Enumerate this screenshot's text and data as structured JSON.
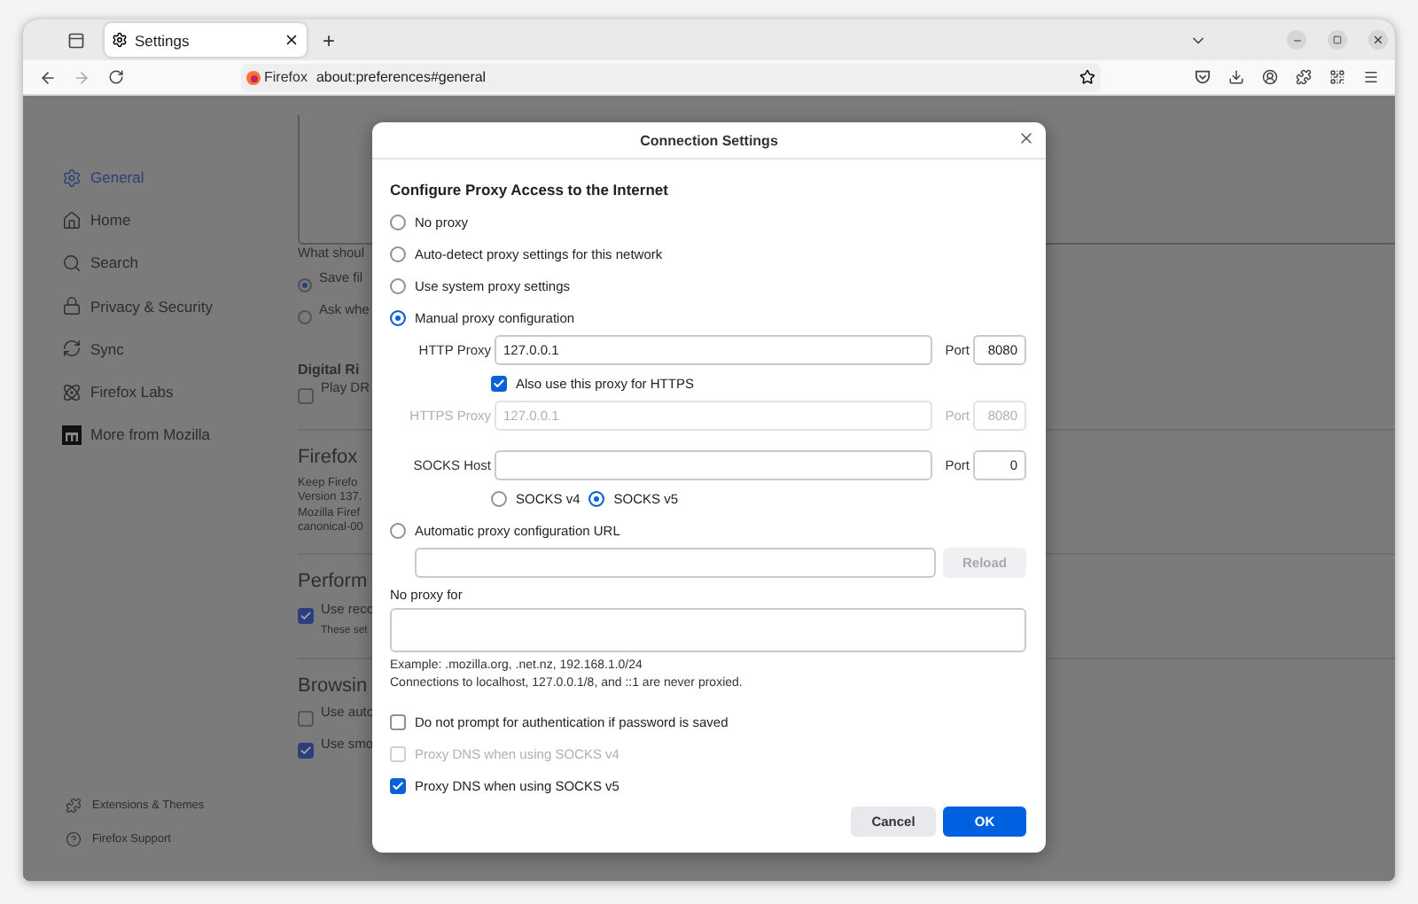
{
  "browser": {
    "tab_title": "Settings",
    "new_tab": "+",
    "identity": "Firefox",
    "url": "about:preferences#general"
  },
  "sidebar": {
    "items": [
      {
        "label": "General",
        "selected": true
      },
      {
        "label": "Home",
        "selected": false
      },
      {
        "label": "Search",
        "selected": false
      },
      {
        "label": "Privacy & Security",
        "selected": false
      },
      {
        "label": "Sync",
        "selected": false
      },
      {
        "label": "Firefox Labs",
        "selected": false
      },
      {
        "label": "More from Mozilla",
        "selected": false
      }
    ],
    "footer": [
      {
        "label": "Extensions & Themes"
      },
      {
        "label": "Firefox Support"
      }
    ]
  },
  "background": {
    "download_prompt": "What shoul",
    "download_options": [
      {
        "label": "Save fil",
        "selected": true
      },
      {
        "label": "Ask whe",
        "selected": false
      }
    ],
    "sections": [
      {
        "title": "Digital Ri",
        "kind": "small",
        "checkboxes": [
          {
            "label": "Play DR",
            "checked": false
          }
        ]
      },
      {
        "title": "Firefox",
        "kind": "large",
        "lines": [
          "Keep Firefo",
          "Version 137.",
          "Mozilla Firef",
          "canonical-00"
        ]
      },
      {
        "title": "Perform",
        "kind": "large",
        "checkboxes": [
          {
            "label": "Use reco",
            "checked": true,
            "note": "These set"
          }
        ]
      },
      {
        "title": "Browsin",
        "kind": "large",
        "checkboxes": [
          {
            "label": "Use auto",
            "checked": false
          },
          {
            "label": "Use smo",
            "checked": true
          }
        ]
      }
    ]
  },
  "dialog": {
    "title": "Connection Settings",
    "heading": "Configure Proxy Access to the Internet",
    "proxy_modes": [
      {
        "label": "No proxy",
        "selected": false
      },
      {
        "label": "Auto-detect proxy settings for this network",
        "selected": false
      },
      {
        "label": "Use system proxy settings",
        "selected": false
      },
      {
        "label": "Manual proxy configuration",
        "selected": true
      }
    ],
    "http": {
      "label": "HTTP Proxy",
      "value": "127.0.0.1",
      "port_label": "Port",
      "port": "8080",
      "disabled": false
    },
    "also_https": {
      "label": "Also use this proxy for HTTPS",
      "checked": true
    },
    "https": {
      "label": "HTTPS Proxy",
      "value": "127.0.0.1",
      "port_label": "Port",
      "port": "8080",
      "disabled": true
    },
    "socks": {
      "label": "SOCKS Host",
      "port_label": "Port",
      "port": "0",
      "disabled": false
    },
    "socks_versions": [
      {
        "label": "SOCKS v4",
        "selected": false
      },
      {
        "label": "SOCKS v5",
        "selected": true
      }
    ],
    "auto_config": {
      "label": "Automatic proxy configuration URL",
      "selected": false,
      "reload": "Reload",
      "reload_disabled": true
    },
    "no_proxy": {
      "label": "No proxy for",
      "hints": [
        "Example: .mozilla.org, .net.nz, 192.168.1.0/24",
        "Connections to localhost, 127.0.0.1/8, and ::1 are never proxied."
      ]
    },
    "options": [
      {
        "label": "Do not prompt for authentication if password is saved",
        "checked": false,
        "disabled": false
      },
      {
        "label": "Proxy DNS when using SOCKS v4",
        "checked": false,
        "disabled": true
      },
      {
        "label": "Proxy DNS when using SOCKS v5",
        "checked": true,
        "disabled": false
      }
    ],
    "buttons": [
      {
        "label": "Cancel",
        "kind": "secondary"
      },
      {
        "label": "OK",
        "kind": "primary"
      }
    ]
  }
}
